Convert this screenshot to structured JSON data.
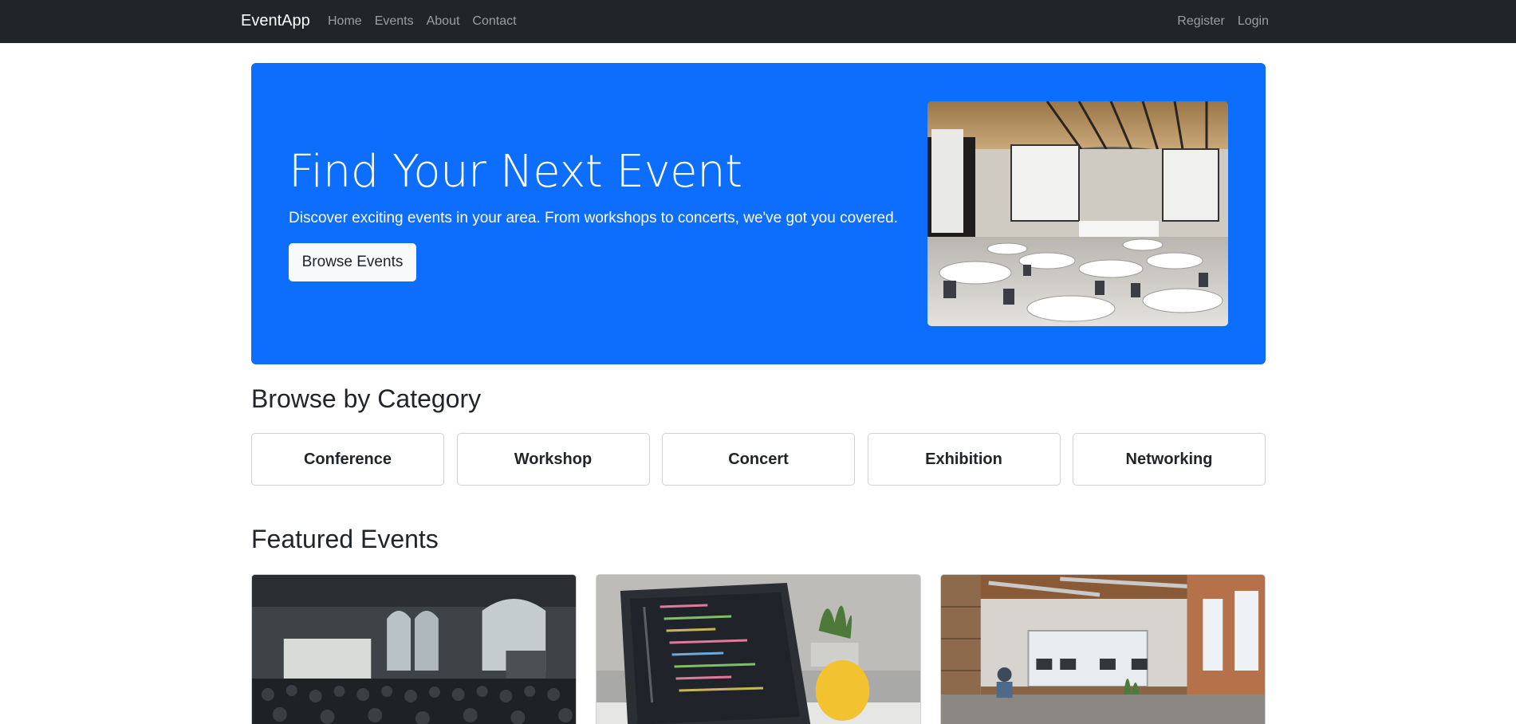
{
  "navbar": {
    "brand": "EventApp",
    "links": [
      "Home",
      "Events",
      "About",
      "Contact"
    ],
    "auth_links": [
      "Register",
      "Login"
    ]
  },
  "hero": {
    "title": "Find Your Next Event",
    "subtitle": "Discover exciting events in your area. From workshops to concerts, we've got you covered.",
    "button_label": "Browse Events",
    "accent_color": "#0d6efd"
  },
  "categories": {
    "title": "Browse by Category",
    "items": [
      "Conference",
      "Workshop",
      "Concert",
      "Exhibition",
      "Networking"
    ]
  },
  "featured": {
    "title": "Featured Events"
  }
}
